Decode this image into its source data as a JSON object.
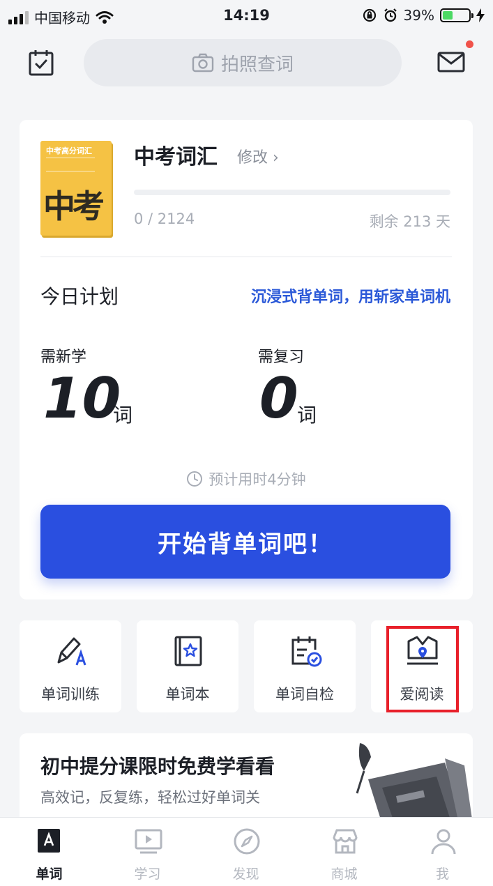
{
  "status_bar": {
    "carrier": "中国移动",
    "time": "14:19",
    "battery": "39%",
    "battery_level": 0.39,
    "battery_color": "#4cd964"
  },
  "header": {
    "search_placeholder": "拍照查词",
    "left_icon": "calendar-check-icon",
    "right_icon": "mail-icon",
    "notification_dot_color": "#f0524a"
  },
  "book": {
    "cover_small_title": "中考高分词汇",
    "cover_big_text": "中考",
    "cover_color": "#f5c244",
    "title": "中考词汇",
    "edit_label": "修改 ›",
    "progress": "0 / 2124",
    "progress_fraction": 0,
    "remaining": "剩余 213 天"
  },
  "plan": {
    "title": "今日计划",
    "promo_link": "沉浸式背单词，用斩家单词机",
    "new_label": "需新学",
    "new_count": "10",
    "new_unit": "词",
    "review_label": "需复习",
    "review_count": "0",
    "review_unit": "词",
    "estimate": "预计用时4分钟",
    "start_button": "开始背单词吧！",
    "accent_color": "#2a4fe0"
  },
  "tiles": [
    {
      "label": "单词训练",
      "icon": "pencil-a-icon"
    },
    {
      "label": "单词本",
      "icon": "star-book-icon"
    },
    {
      "label": "单词自检",
      "icon": "clipboard-check-icon"
    },
    {
      "label": "爱阅读",
      "icon": "open-book-icon",
      "highlighted": true
    }
  ],
  "promo": {
    "title": "初中提分课限时免费学看看",
    "subtitle": "高效记，反复练，轻松过好单词关"
  },
  "tabbar": [
    {
      "label": "单词",
      "icon": "letter-a-book-icon",
      "active": true
    },
    {
      "label": "学习",
      "icon": "video-play-icon"
    },
    {
      "label": "发现",
      "icon": "compass-icon"
    },
    {
      "label": "商城",
      "icon": "store-icon"
    },
    {
      "label": "我",
      "icon": "person-icon"
    }
  ]
}
